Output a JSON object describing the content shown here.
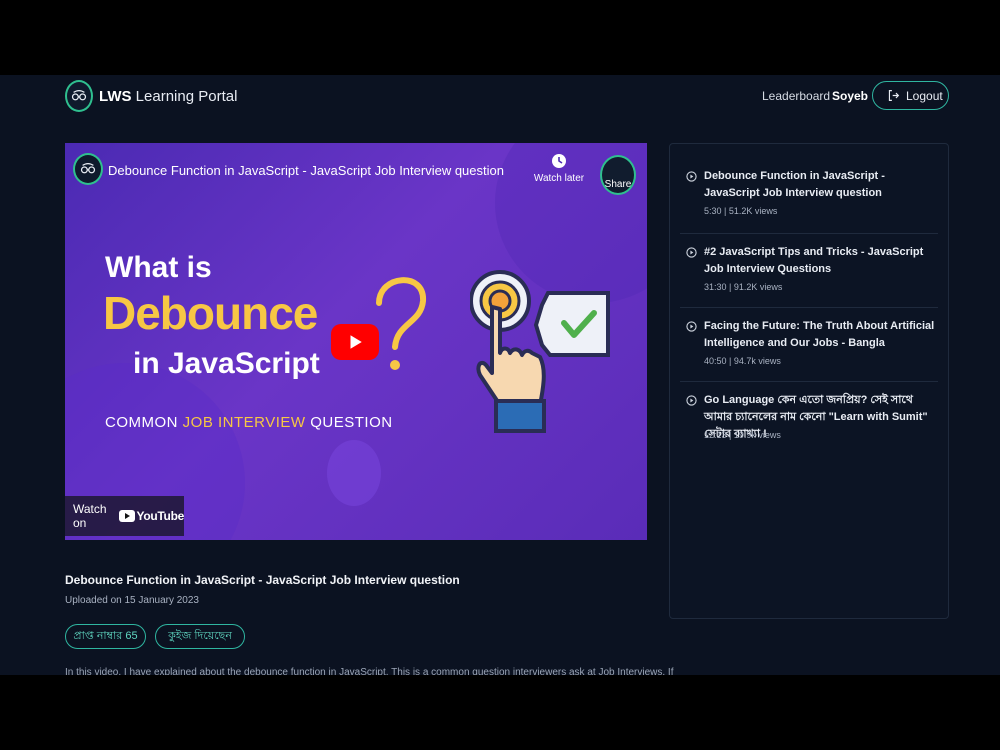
{
  "header": {
    "brand_bold": "LWS",
    "brand_rest": "Learning Portal",
    "nav_leaderboard": "Leaderboard",
    "user_name": "Soyeb",
    "logout_label": "Logout"
  },
  "video": {
    "title": "Debounce Function in JavaScript - JavaScript Job Interview question",
    "watch_later": "Watch later",
    "share": "Share",
    "thumb_line1": "What is",
    "thumb_line2": "Debounce",
    "thumb_line3": "in JavaScript",
    "thumb_line4_a": "COMMON ",
    "thumb_line4_b": "JOB INTERVIEW",
    "thumb_line4_c": " QUESTION",
    "watch_on": "Watch on",
    "youtube": "YouTube"
  },
  "details": {
    "title": "Debounce Function in JavaScript - JavaScript Job Interview question",
    "uploaded": "Uploaded on 15 January 2023",
    "badge_mark": "প্রাপ্ত নাম্বার 65",
    "badge_quiz": "কুইজ দিয়েছেন",
    "description": "In this video, I have explained about the debounce function in JavaScript. This is a common question interviewers ask at Job Interviews. If"
  },
  "playlist": [
    {
      "title": "Debounce Function in JavaScript - JavaScript Job Interview question",
      "meta": "5:30 | 51.2K views"
    },
    {
      "title": "#2 JavaScript Tips and Tricks - JavaScript Job Interview Questions",
      "meta": "31:30 | 91.2K views"
    },
    {
      "title": "Facing the Future: The Truth About Artificial Intelligence and Our Jobs - Bangla",
      "meta": "40:50 | 94.7k views"
    },
    {
      "title": "Go Language কেন এতো জনপ্রিয়? সেই সাথে আমার চ্যানেলের নাম কেনো \"Learn with Sumit\" সেটার ব্যাখ্যা !",
      "meta": "12:13 | 19.9k views"
    }
  ],
  "colors": {
    "background": "#0b1221",
    "accent": "#2fb5a0",
    "thumbnail_yellow": "#f7c744",
    "thumbnail_purple": "#5a2cb8",
    "youtube_red": "#ff0000"
  }
}
